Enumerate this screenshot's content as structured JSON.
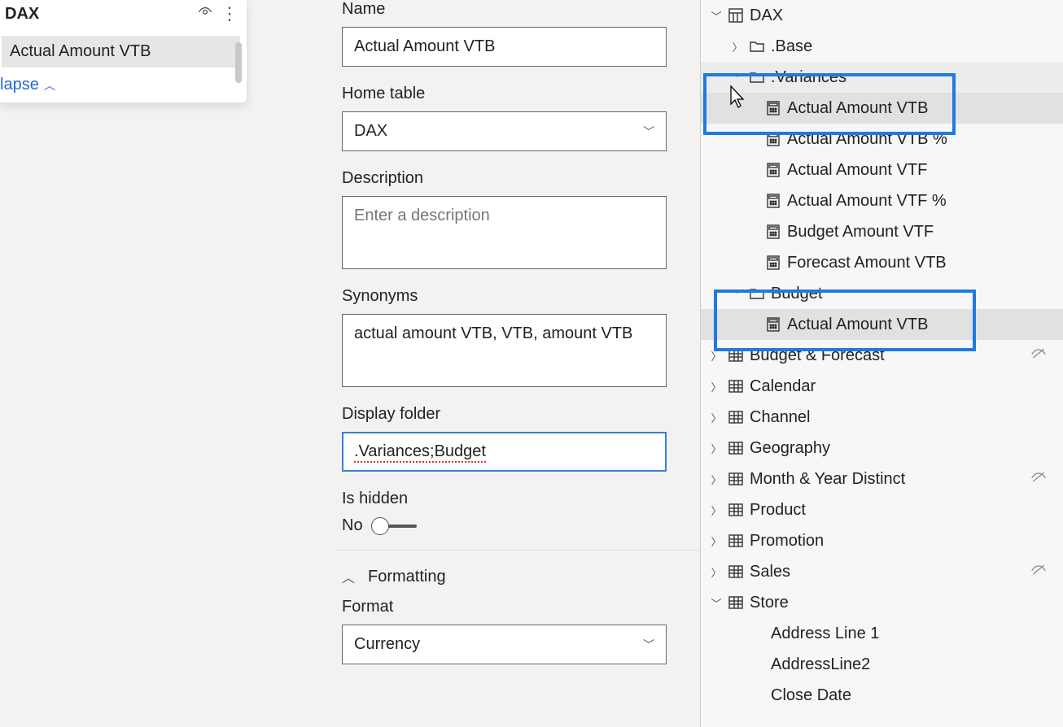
{
  "leftPanel": {
    "title": "DAX",
    "selectedMeasure": "Actual Amount VTB",
    "collapse": "lapse"
  },
  "properties": {
    "nameLabel": "Name",
    "nameValue": "Actual Amount VTB",
    "homeTableLabel": "Home table",
    "homeTableValue": "DAX",
    "descriptionLabel": "Description",
    "descriptionPlaceholder": "Enter a description",
    "synonymsLabel": "Synonyms",
    "synonymsValue": "actual amount VTB, VTB, amount VTB",
    "displayFolderLabel": "Display folder",
    "displayFolderValue": ".Variances;Budget",
    "isHiddenLabel": "Is hidden",
    "isHiddenValue": "No",
    "formattingHeader": "Formatting",
    "formatLabel": "Format",
    "formatValue": "Currency"
  },
  "tree": {
    "dax": "DAX",
    "base": ".Base",
    "variances": ".Variances",
    "measures": {
      "m1": "Actual Amount VTB",
      "m2": "Actual Amount VTB %",
      "m3": "Actual Amount VTF",
      "m4": "Actual Amount VTF %",
      "m5": "Budget Amount VTF",
      "m6": "Forecast Amount VTB"
    },
    "budgetFolder": "Budget",
    "budgetMeasure": "Actual Amount VTB",
    "tables": {
      "t1": "Budget & Forecast",
      "t2": "Calendar",
      "t3": "Channel",
      "t4": "Geography",
      "t5": "Month & Year Distinct",
      "t6": "Product",
      "t7": "Promotion",
      "t8": "Sales",
      "t9": "Store"
    },
    "storeCols": {
      "c1": "Address Line 1",
      "c2": "AddressLine2",
      "c3": "Close Date"
    }
  }
}
